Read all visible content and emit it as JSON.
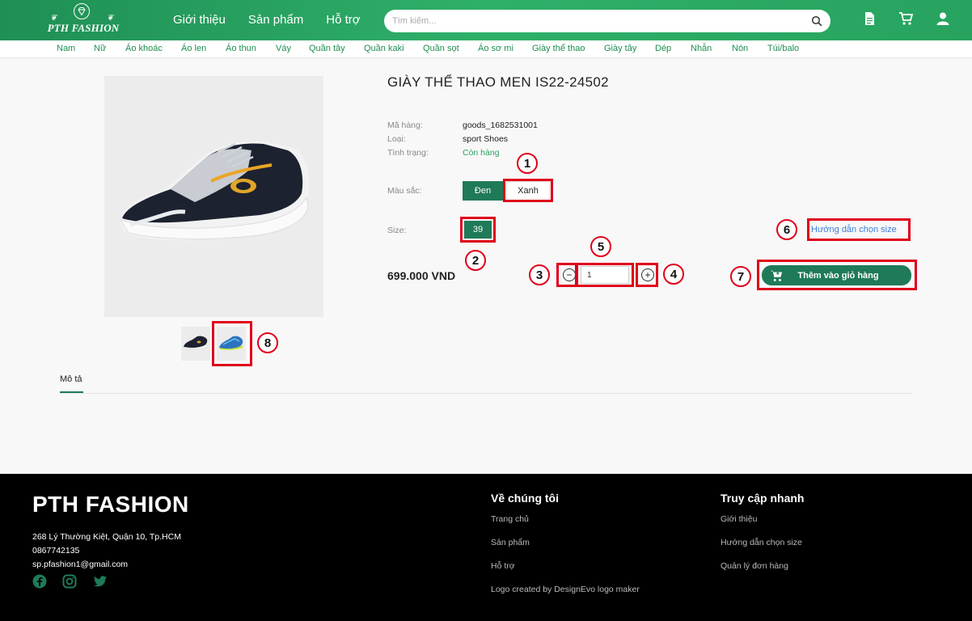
{
  "header": {
    "logo_text": "PTH FASHION",
    "nav": [
      "Giới thiệu",
      "Sản phẩm",
      "Hỗ trợ"
    ],
    "search_placeholder": "Tìm kiếm...",
    "icons": [
      "document-icon",
      "cart-icon",
      "user-icon"
    ]
  },
  "categories": [
    "Nam",
    "Nữ",
    "Áo khoác",
    "Áo len",
    "Áo thun",
    "Váy",
    "Quần tây",
    "Quần kaki",
    "Quần sọt",
    "Áo sơ mi",
    "Giày thể thao",
    "Giày tây",
    "Dép",
    "Nhẫn",
    "Nón",
    "Túi/balo"
  ],
  "product": {
    "title": "GIÀY THỂ THAO MEN IS22-24502",
    "labels": {
      "code": "Mã hàng:",
      "type": "Loại:",
      "status": "Tình trạng:",
      "color": "Màu sắc:",
      "size": "Size:"
    },
    "code": "goods_1682531001",
    "type": "sport Shoes",
    "status": "Còn hàng",
    "colors": [
      "Đen",
      "Xanh"
    ],
    "size": "39",
    "size_guide": "Hướng dẫn chọn size",
    "price": "699.000 VND",
    "quantity": "1",
    "add_to_cart": "Thêm vào giỏ hàng"
  },
  "tabs": {
    "description": "Mô tả"
  },
  "annotations": [
    "1",
    "2",
    "3",
    "4",
    "5",
    "6",
    "7",
    "8"
  ],
  "footer": {
    "brand": "PTH FASHION",
    "address": "268 Lý Thường Kiệt, Quận 10, Tp.HCM",
    "phone": "0867742135",
    "email": "sp.pfashion1@gmail.com",
    "about_title": "Về chúng tôi",
    "about_links": [
      "Trang chủ",
      "Sản phẩm",
      "Hỗ trợ",
      "Logo created by DesignEvo logo maker"
    ],
    "quick_title": "Truy cập nhanh",
    "quick_links": [
      "Giới thiệu",
      "Hướng dẫn chọn size",
      "Quản lý đơn hàng"
    ]
  },
  "colors": {
    "primary": "#1f7a58",
    "header": "#2aa35f",
    "annotation": "#e0001a",
    "link": "#3b7fd6"
  }
}
